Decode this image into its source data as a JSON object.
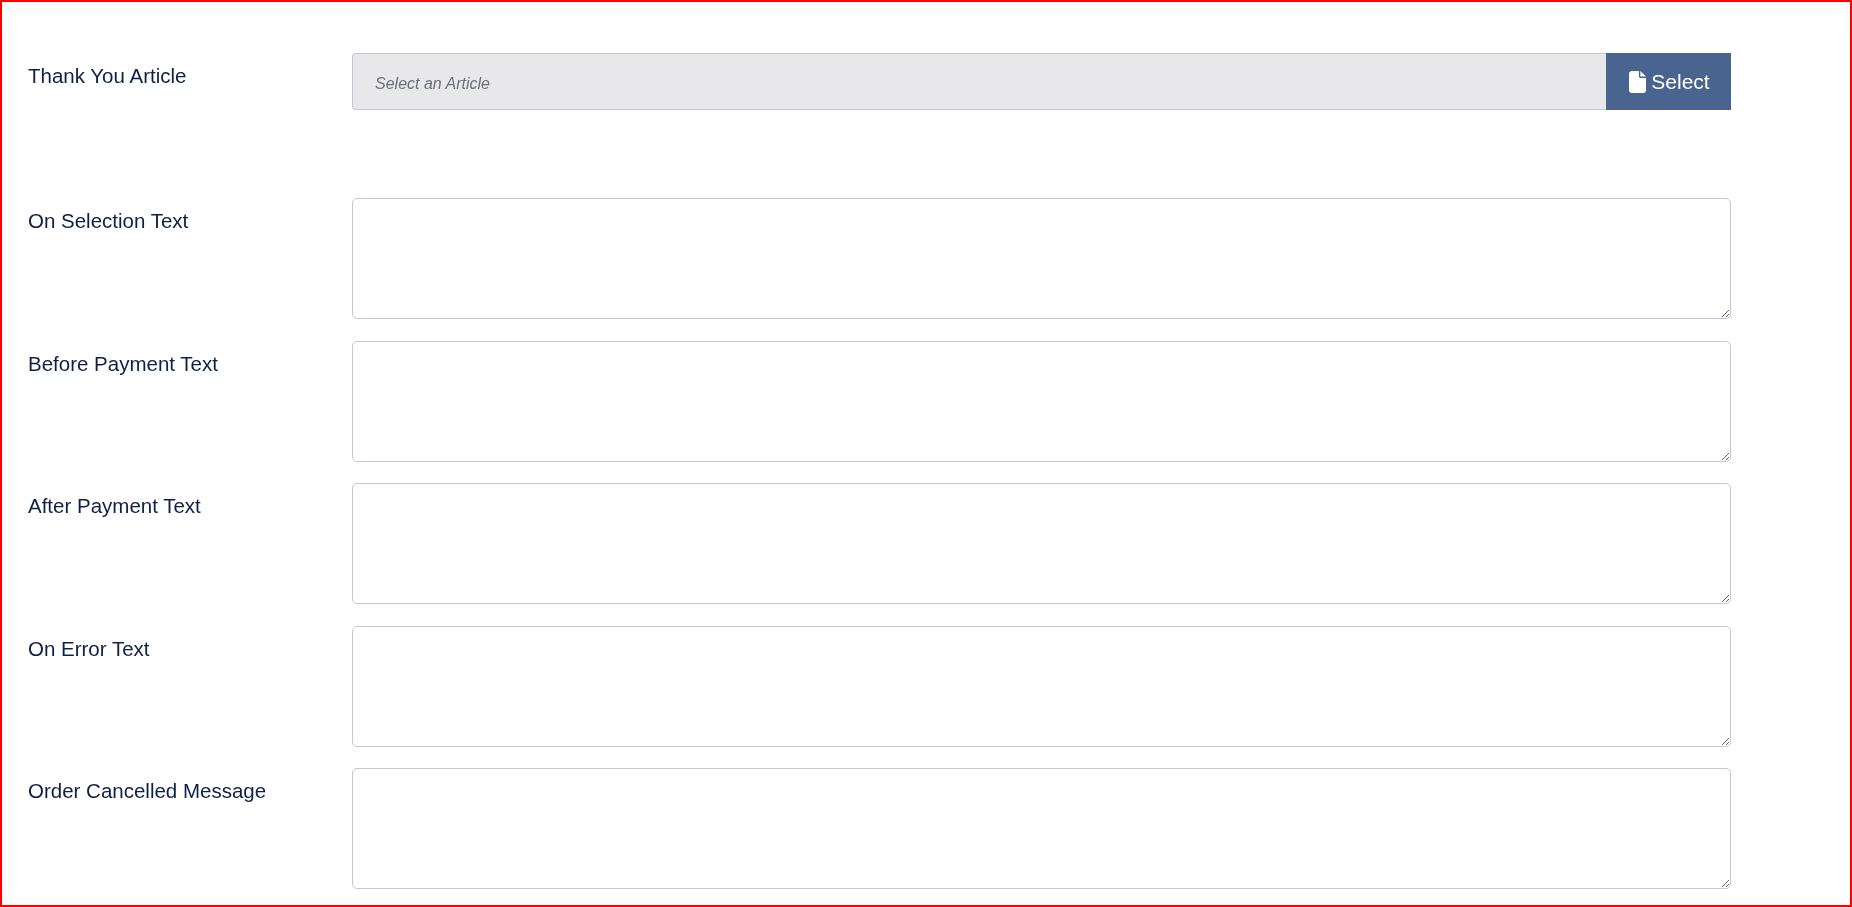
{
  "fields": [
    {
      "kind": "article-picker",
      "label": "Thank You Article",
      "placeholder": "Select an Article",
      "button": "Select"
    },
    {
      "kind": "textarea",
      "label": "On Selection Text"
    },
    {
      "kind": "textarea",
      "label": "Before Payment Text"
    },
    {
      "kind": "textarea",
      "label": "After Payment Text"
    },
    {
      "kind": "textarea",
      "label": "On Error Text"
    },
    {
      "kind": "textarea",
      "label": "Order Cancelled Message"
    }
  ]
}
